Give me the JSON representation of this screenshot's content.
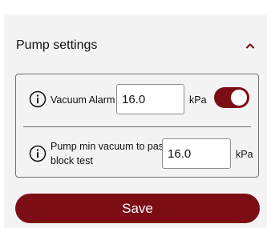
{
  "pump_settings": {
    "title": "Pump settings",
    "expanded": true,
    "collapse_icon": "chevron-up-icon"
  },
  "vacuum_alarm": {
    "info_icon": "info-icon",
    "label": "Vacuum Alarm",
    "value": "16.0",
    "unit": "kPa",
    "enabled": true
  },
  "pump_min_vacuum": {
    "info_icon": "info-icon",
    "label_line1": "Pump min vacuum to pass",
    "label_line2": "block test",
    "value": "16.0",
    "unit": "kPa"
  },
  "save_button": {
    "label": "Save"
  },
  "colors": {
    "accent": "#7d0d15",
    "panel_background": "#f3f3f3",
    "border": "#707070"
  }
}
